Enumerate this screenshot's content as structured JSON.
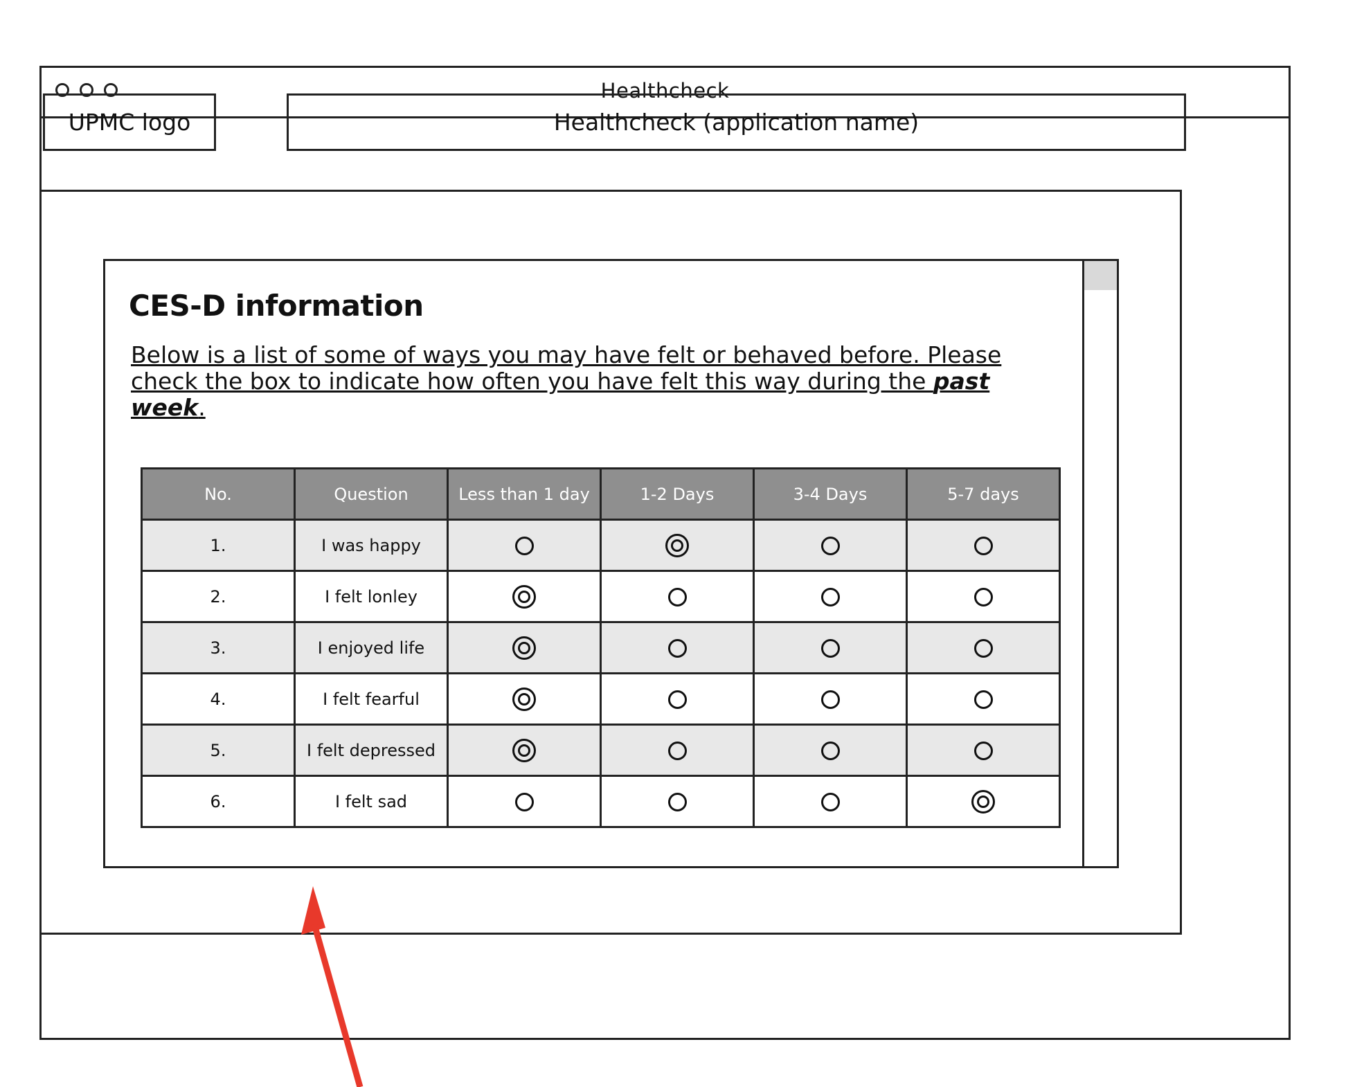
{
  "window": {
    "title": "Healthcheck"
  },
  "header": {
    "logo_text": "UPMC logo",
    "app_name": "Healthcheck (application name)"
  },
  "panel": {
    "title": "CES-D information",
    "instructions_start": "Below is a list of some of ways you may have felt or behaved before. Please check the box to indicate how often you have felt this way during the ",
    "instructions_emphasis": "past week",
    "instructions_end": "."
  },
  "table": {
    "headers": [
      "No.",
      "Question",
      "Less than 1 day",
      "1-2 Days",
      "3-4 Days",
      "5-7 days"
    ],
    "rows": [
      {
        "no": "1.",
        "question": "I was happy",
        "selected": 1
      },
      {
        "no": "2.",
        "question": "I felt lonley",
        "selected": 0
      },
      {
        "no": "3.",
        "question": "I enjoyed life",
        "selected": 0
      },
      {
        "no": "4.",
        "question": "I felt fearful",
        "selected": 0
      },
      {
        "no": "5.",
        "question": "I felt depressed",
        "selected": 0
      },
      {
        "no": "6.",
        "question": "I felt sad",
        "selected": 3
      }
    ]
  },
  "colors": {
    "header_bg": "#8f8f8f",
    "shaded_row": "#e8e8e8",
    "annotation_arrow": "#e8392b"
  }
}
